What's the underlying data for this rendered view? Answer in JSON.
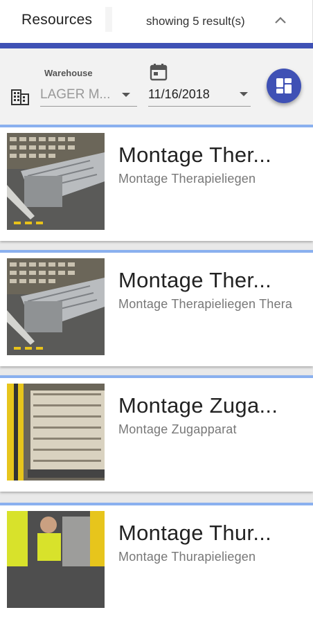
{
  "header": {
    "title": "Resources",
    "result_count": "showing 5 result(s)",
    "collapse_icon": "chevron-up-icon"
  },
  "filters": {
    "warehouse_label": "Warehouse",
    "warehouse_value": "LAGER M...",
    "warehouse_icon": "building-icon",
    "date_icon": "calendar-icon",
    "date_value": "11/16/2018",
    "view_toggle_icon": "dashboard-icon"
  },
  "colors": {
    "accent": "#3f51b5",
    "card_top_border": "#8ab0ef"
  },
  "cards": [
    {
      "title": "Montage Ther...",
      "subtitle": "Montage Therapieliegen",
      "image": "conveyor-machine-photo"
    },
    {
      "title": "Montage Ther...",
      "subtitle": "Montage Therapieliegen Thera",
      "image": "conveyor-machine-photo"
    },
    {
      "title": "Montage Zuga...",
      "subtitle": "Montage Zugapparat",
      "image": "forklift-pallet-photo"
    },
    {
      "title": "Montage Thur...",
      "subtitle": "Montage Thurapieliegen",
      "image": "forklift-operator-photo"
    }
  ]
}
